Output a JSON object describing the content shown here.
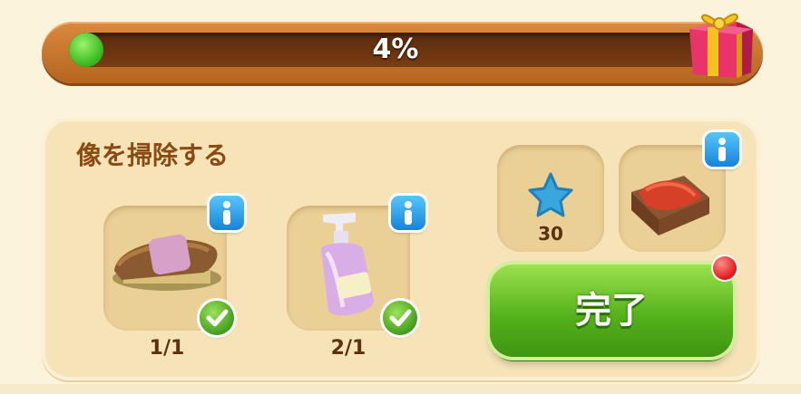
{
  "progress": {
    "value_percent": 4,
    "label": "4%",
    "icon": "gift-icon"
  },
  "task": {
    "title": "像を掃除する",
    "items": [
      {
        "name": "brush",
        "icon": "brush-icon",
        "count": "1/1",
        "completed": true
      },
      {
        "name": "soap",
        "icon": "soap-bottle-icon",
        "count": "2/1",
        "completed": true
      }
    ]
  },
  "rewards": [
    {
      "icon": "blue-star-icon",
      "count": "30"
    },
    {
      "icon": "crate-icon",
      "count": ""
    }
  ],
  "done_button": {
    "label": "完了"
  },
  "colors": {
    "progress_fill": "#34b51e",
    "done_button": "#56b21b",
    "title": "#8b4a12",
    "info": "#1684d8",
    "notification": "#e01818"
  }
}
